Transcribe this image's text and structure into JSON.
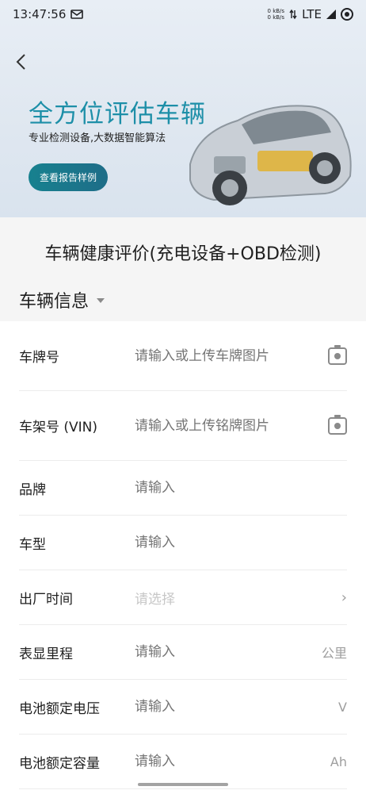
{
  "status_bar": {
    "time": "13:47:56",
    "net_up": "0 kB/s",
    "net_down": "0 kB/s",
    "network": "LTE"
  },
  "banner": {
    "title": "全方位评估车辆",
    "subtitle": "专业检测设备,大数据智能算法",
    "button_label": "查看报告样例"
  },
  "page_title": "车辆健康评价(充电设备+OBD检测)",
  "section_title": "车辆信息",
  "form": {
    "rows": [
      {
        "label": "车牌号",
        "placeholder": "请输入或上传车牌图片"
      },
      {
        "label": "车架号 (VIN)",
        "placeholder": "请输入或上传铭牌图片"
      },
      {
        "label": "品牌",
        "placeholder": "请输入"
      },
      {
        "label": "车型",
        "placeholder": "请输入"
      },
      {
        "label": "出厂时间",
        "placeholder": "请选择"
      },
      {
        "label": "表显里程",
        "placeholder": "请输入",
        "suffix": "公里"
      },
      {
        "label": "电池额定电压",
        "placeholder": "请输入",
        "suffix": "V"
      },
      {
        "label": "电池额定容量",
        "placeholder": "请输入",
        "suffix": "Ah"
      }
    ]
  },
  "colors": {
    "accent": "#1d8fa8",
    "button": "#17818f"
  }
}
